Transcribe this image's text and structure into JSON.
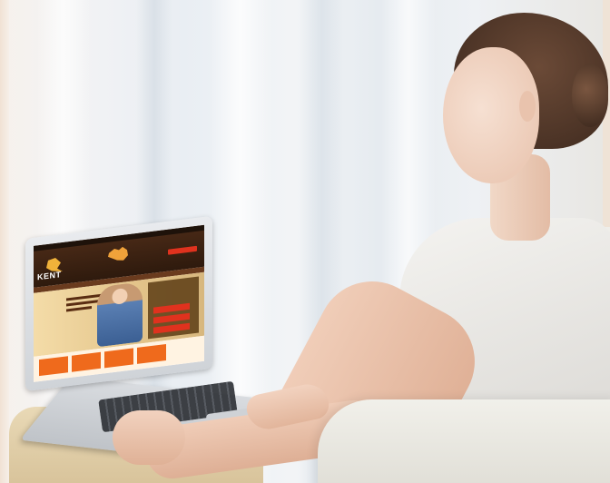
{
  "scene": {
    "description_tags": [
      "woman-seated-in-armchair",
      "laptop-on-lap",
      "sheer-curtains-background"
    ],
    "colors": {
      "curtain_light": "#f2f4f6",
      "shirt": "#f4f3f0",
      "hair": "#4a3224",
      "skin": "#f0cdb8",
      "trousers": "#e9d9b6",
      "laptop_silver": "#d9dce0"
    }
  },
  "laptop_screen": {
    "site_brand_text": "KENT",
    "colors": {
      "header_brown": "#3c2212",
      "accent_red": "#e0321e",
      "accent_orange": "#ef6a1c",
      "hero_tan": "#e3c48a"
    },
    "icons": [
      "kangaroo-logo-icon",
      "australia-map-icon"
    ]
  }
}
